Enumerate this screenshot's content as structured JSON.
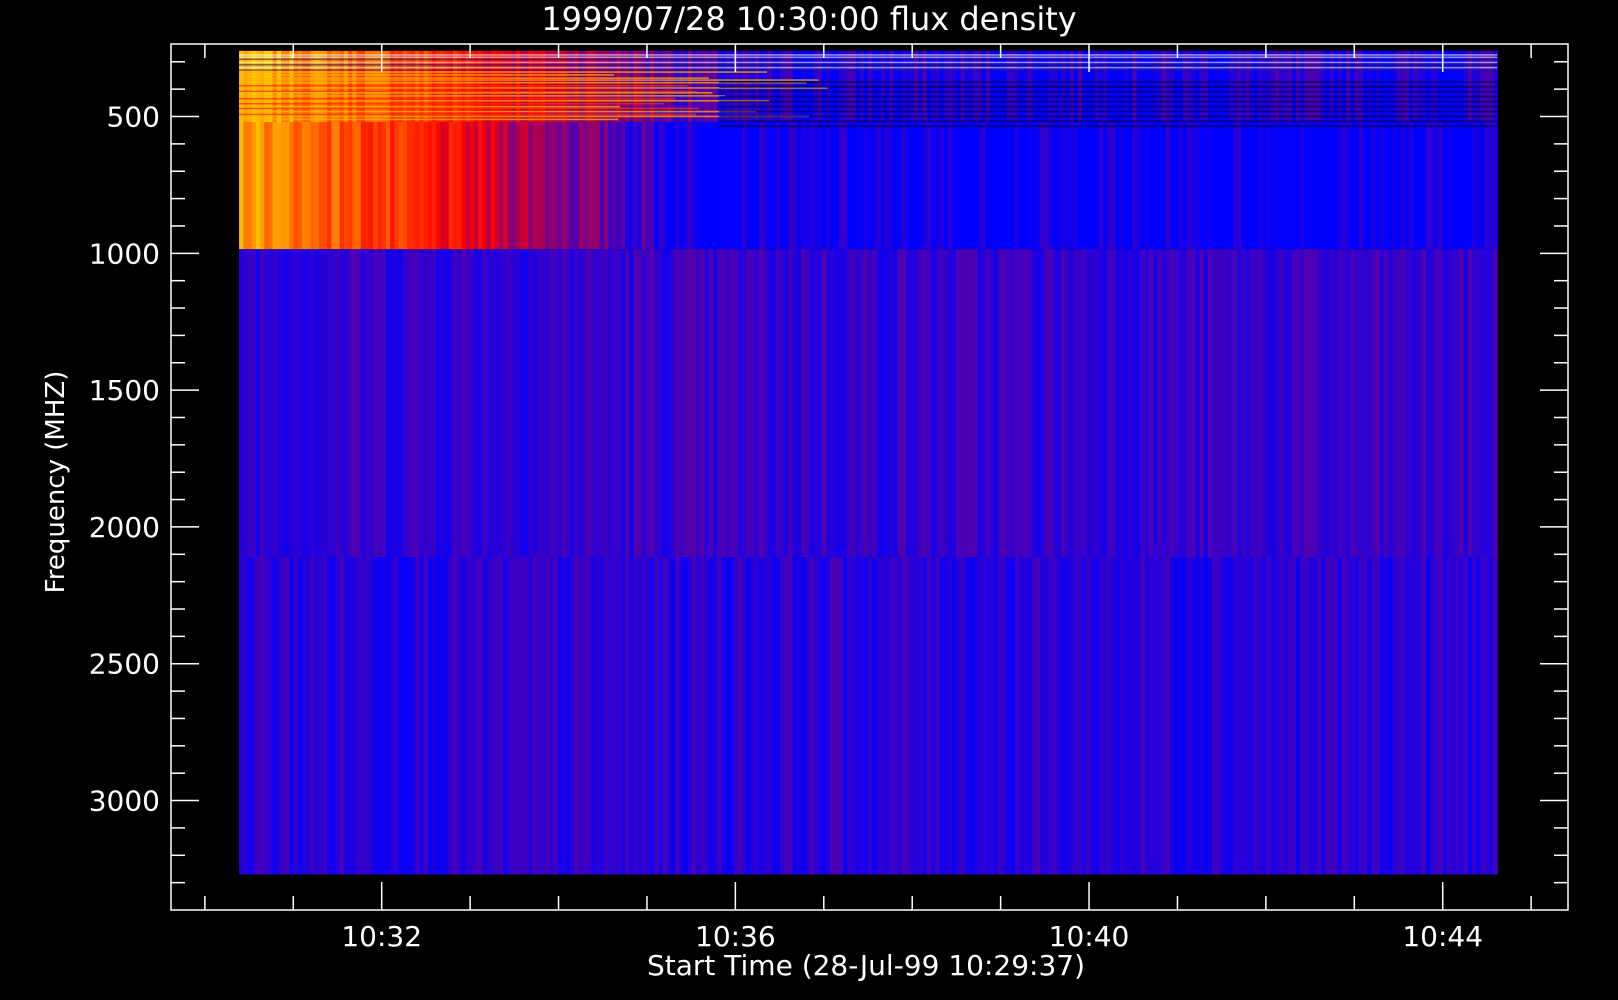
{
  "chart_data": {
    "type": "heatmap",
    "title": "1999/07/28 10:30:00 flux density",
    "xlabel": "Start Time (28-Jul-99 10:29:37)",
    "ylabel": "Frequency (MHZ)",
    "x_unit": "minutes after 10:29:37",
    "xlim": [
      0,
      15.8
    ],
    "ylim": [
      3400,
      235
    ],
    "y_inverted": true,
    "xticks": [
      {
        "value": 2.383,
        "label": "10:32"
      },
      {
        "value": 6.383,
        "label": "10:36"
      },
      {
        "value": 10.383,
        "label": "10:40"
      },
      {
        "value": 14.383,
        "label": "10:44"
      }
    ],
    "yticks": [
      {
        "value": 500,
        "label": "500"
      },
      {
        "value": 1000,
        "label": "1000"
      },
      {
        "value": 1500,
        "label": "1500"
      },
      {
        "value": 2000,
        "label": "2000"
      },
      {
        "value": 2500,
        "label": "2500"
      },
      {
        "value": 3000,
        "label": "3000"
      }
    ],
    "data_extent": {
      "x": [
        0.77,
        15.0
      ],
      "y": [
        260,
        3270
      ]
    },
    "bands": [
      {
        "y": [
          260,
          520
        ],
        "description": "hot emission with many horizontal lines",
        "intensity_start": 0.95,
        "intensity_end": 0.05,
        "fade_until": 6.5
      },
      {
        "y": [
          520,
          985
        ],
        "description": "burst decaying with time",
        "intensity_start": 0.9,
        "intensity_end": 0.0,
        "fade_until": 6.0
      },
      {
        "y": [
          985,
          2110
        ],
        "description": "background",
        "intensity": 0.1
      },
      {
        "y": [
          2110,
          3270
        ],
        "description": "background",
        "intensity": 0.08
      }
    ],
    "colormap": {
      "low": "#0000ff",
      "mid": "#ff0000",
      "high": "#ffd000"
    },
    "grid": false,
    "legend": "none"
  },
  "colors": {
    "background": "#000000",
    "axes": "#ffffff",
    "low": "#0000ff",
    "high": "#ff2000"
  }
}
